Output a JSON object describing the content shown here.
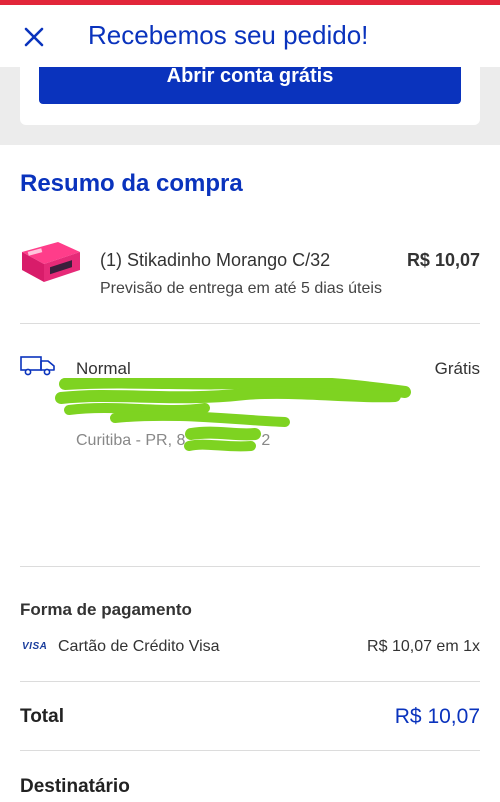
{
  "header": {
    "title": "Recebemos seu pedido!",
    "close_icon": "close-icon"
  },
  "cta": {
    "open_account_label": "Abrir conta grátis"
  },
  "summary": {
    "title": "Resumo da compra",
    "product": {
      "name": "(1) Stikadinho Morango C/32",
      "price": "R$ 10,07",
      "eta": "Previsão de entrega em até 5 dias úteis",
      "thumb_icon": "product-box-image"
    }
  },
  "shipping": {
    "icon": "truck-icon",
    "method": "Normal",
    "price": "Grátis",
    "city_line": "Curitiba - PR, 8",
    "city_line_end": "2"
  },
  "payment": {
    "title": "Forma de pagamento",
    "card_brand": "VISA",
    "method": "Cartão de Crédito Visa",
    "amount": "R$ 10,07 em 1x"
  },
  "total": {
    "label": "Total",
    "value": "R$ 10,07"
  },
  "recipient": {
    "title": "Destinatário"
  },
  "colors": {
    "brand_blue": "#0a33bd",
    "top_strip_red": "#e2263a",
    "redaction_green": "#7ed321"
  }
}
